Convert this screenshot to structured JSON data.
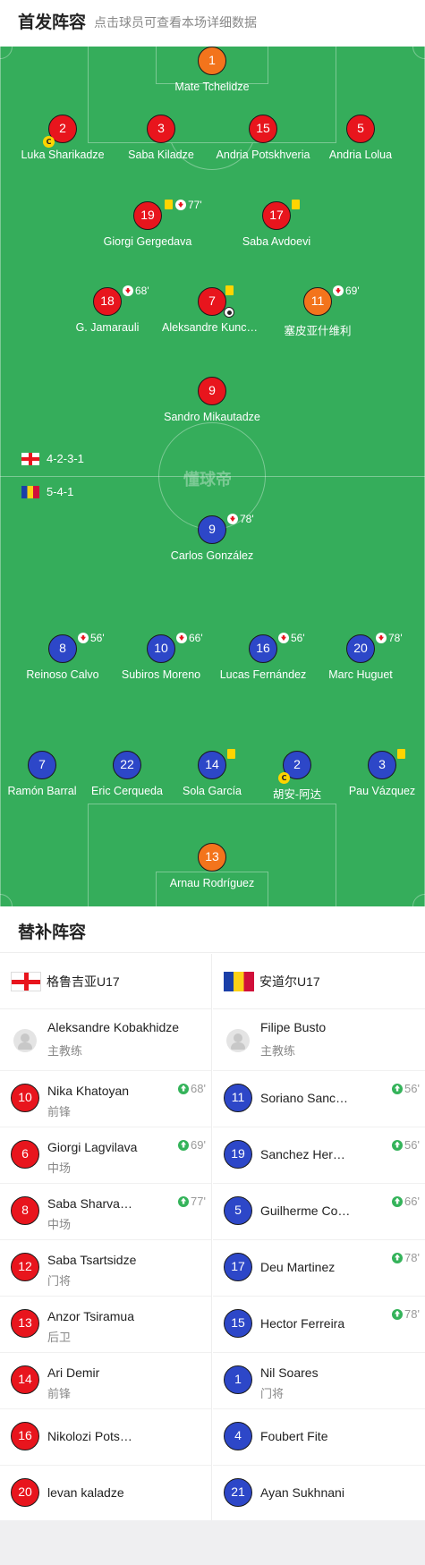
{
  "header": {
    "title": "首发阵容",
    "subtitle": "点击球员可查看本场详细数据"
  },
  "pitch": {
    "watermark": "懂球帝",
    "home_formation": "4-2-3-1",
    "away_formation": "5-4-1",
    "home": [
      {
        "num": "1",
        "name": "Mate Tchelidze",
        "color": "orange"
      },
      {
        "num": "2",
        "name": "Luka Sharikadze",
        "color": "red",
        "captain": "C"
      },
      {
        "num": "3",
        "name": "Saba Kiladze",
        "color": "red"
      },
      {
        "num": "15",
        "name": "Andria Potskhveria",
        "color": "red"
      },
      {
        "num": "5",
        "name": "Andria Lolua",
        "color": "red"
      },
      {
        "num": "19",
        "name": "Giorgi Gergedava",
        "color": "red",
        "sub": "77'"
      },
      {
        "num": "17",
        "name": "Saba Avdoevi",
        "color": "red"
      },
      {
        "num": "18",
        "name": "G. Jamarauli",
        "color": "red",
        "sub": "68'"
      },
      {
        "num": "7",
        "name": "Aleksandre Kunchulia",
        "color": "red"
      },
      {
        "num": "11",
        "name": "塞皮亚什维利",
        "color": "orange",
        "sub": "69'"
      },
      {
        "num": "9",
        "name": "Sandro Mikautadze",
        "color": "red"
      }
    ],
    "away": [
      {
        "num": "9",
        "name": "Carlos González",
        "sub": "78'"
      },
      {
        "num": "8",
        "name": "Reinoso Calvo",
        "sub": "56'"
      },
      {
        "num": "10",
        "name": "Subiros Moreno",
        "sub": "66'"
      },
      {
        "num": "16",
        "name": "Lucas Fernández",
        "sub": "56'"
      },
      {
        "num": "20",
        "name": "Marc Huguet",
        "sub": "78'"
      },
      {
        "num": "7",
        "name": "Ramón Barral"
      },
      {
        "num": "22",
        "name": "Eric Cerqueda"
      },
      {
        "num": "14",
        "name": "Sola García"
      },
      {
        "num": "2",
        "name": "胡安-阿达",
        "captain": "C"
      },
      {
        "num": "3",
        "name": "Pau Vázquez"
      },
      {
        "num": "13",
        "name": "Arnau Rodríguez"
      }
    ]
  },
  "subs": {
    "title": "替补阵容",
    "home": {
      "team": "格鲁吉亚U17",
      "coach": {
        "name": "Aleksandre Kobakhidze",
        "role": "主教练"
      },
      "players": [
        {
          "num": "10",
          "name": "Nika Khatoyan",
          "pos": "前锋",
          "sub": "68'",
          "color": "red"
        },
        {
          "num": "6",
          "name": "Giorgi Lagvilava",
          "pos": "中场",
          "sub": "69'",
          "color": "red"
        },
        {
          "num": "8",
          "name": "Saba Sharva…",
          "pos": "中场",
          "sub": "77'",
          "color": "red"
        },
        {
          "num": "12",
          "name": "Saba Tsartsidze",
          "pos": "门将",
          "sub": "",
          "color": "red"
        },
        {
          "num": "13",
          "name": "Anzor Tsiramua",
          "pos": "后卫",
          "sub": "",
          "color": "red"
        },
        {
          "num": "14",
          "name": "Ari Demir",
          "pos": "前锋",
          "sub": "",
          "color": "red"
        },
        {
          "num": "16",
          "name": "Nikolozi Pots…",
          "pos": "",
          "sub": "",
          "color": "red"
        },
        {
          "num": "20",
          "name": "levan kaladze",
          "pos": "",
          "sub": "",
          "color": "red"
        }
      ]
    },
    "away": {
      "team": "安道尔U17",
      "coach": {
        "name": "Filipe Busto",
        "role": "主教练"
      },
      "players": [
        {
          "num": "11",
          "name": "Soriano Sanc…",
          "pos": "",
          "sub": "56'",
          "color": "blue"
        },
        {
          "num": "19",
          "name": "Sanchez Her…",
          "pos": "",
          "sub": "56'",
          "color": "blue"
        },
        {
          "num": "5",
          "name": "Guilherme Co…",
          "pos": "",
          "sub": "66'",
          "color": "blue"
        },
        {
          "num": "17",
          "name": "Deu Martinez",
          "pos": "",
          "sub": "78'",
          "color": "blue"
        },
        {
          "num": "15",
          "name": "Hector Ferreira",
          "pos": "",
          "sub": "78'",
          "color": "blue"
        },
        {
          "num": "1",
          "name": "Nil Soares",
          "pos": "门将",
          "sub": "",
          "color": "blue"
        },
        {
          "num": "4",
          "name": "Foubert Fite",
          "pos": "",
          "sub": "",
          "color": "blue"
        },
        {
          "num": "21",
          "name": "Ayan Sukhnani",
          "pos": "",
          "sub": "",
          "color": "blue"
        }
      ]
    }
  }
}
